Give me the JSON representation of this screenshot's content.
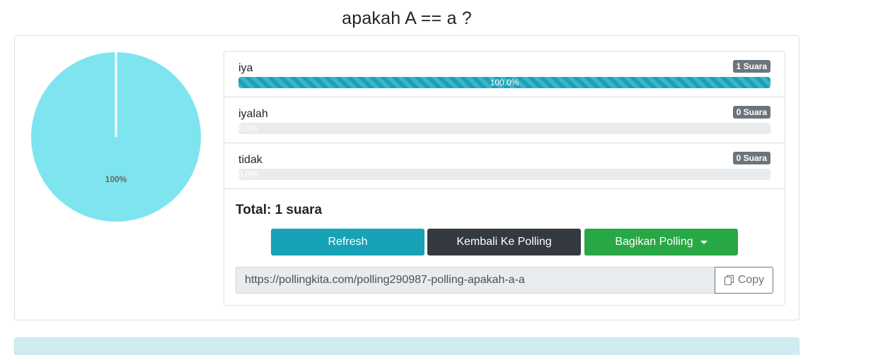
{
  "poll": {
    "title": "apakah A == a ?"
  },
  "chart_data": {
    "type": "pie",
    "categories": [
      "iya",
      "iyalah",
      "tidak"
    ],
    "values": [
      100,
      0,
      0
    ],
    "colors": [
      "#7ee5f0",
      "#7ee5f0",
      "#7ee5f0"
    ],
    "slice_label": "100%"
  },
  "options": [
    {
      "label": "iya",
      "votes": "1 Suara",
      "percent_text": "100.0%",
      "fraction": 1.0
    },
    {
      "label": "iyalah",
      "votes": "0 Suara",
      "percent_text": "0.0%",
      "fraction": 0.0
    },
    {
      "label": "tidak",
      "votes": "0 Suara",
      "percent_text": "0.0%",
      "fraction": 0.0
    }
  ],
  "total_label": "Total: 1 suara",
  "buttons": {
    "refresh": "Refresh",
    "back": "Kembali Ke Polling",
    "share": "Bagikan Polling"
  },
  "share_url": {
    "value": "https://pollingkita.com/polling290987-polling-apakah-a-a",
    "copy_label": "Copy"
  },
  "colors": {
    "info": "#17a2b8",
    "dark": "#343a40",
    "success": "#28a745",
    "badge": "#6c757d",
    "pie_fill": "#7ee5f0"
  }
}
